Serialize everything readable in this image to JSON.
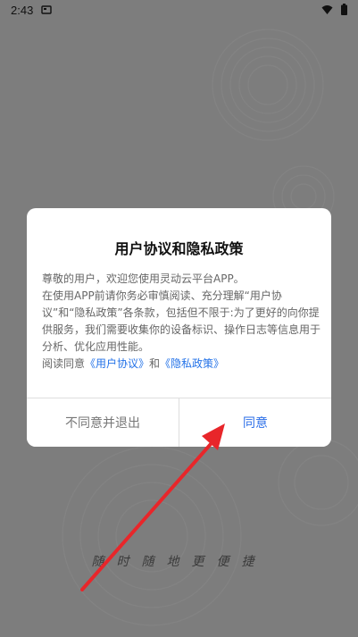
{
  "status_bar": {
    "time": "2:43",
    "icons": [
      "notification-icon",
      "wifi-icon",
      "battery-icon"
    ]
  },
  "dialog": {
    "title": "用户协议和隐私政策",
    "body_para1": "尊敬的用户，欢迎您使用灵动云平台APP。",
    "body_para2": "在使用APP前请你务必审慎阅读、充分理解“用户协议”和“隐私政策”各条款，包括但不限于:为了更好的向你提供服务，我们需要收集你的设备标识、操作日志等信息用于分析、优化应用性能。",
    "read_prefix": "阅读同意",
    "link_user_agreement": "《用户协议》",
    "conjunction": "和",
    "link_privacy_policy": "《隐私政策》",
    "decline_label": "不同意并退出",
    "agree_label": "同意"
  },
  "slogan": "随时随地更便捷",
  "colors": {
    "overlay": "#7d7d7d",
    "link": "#2372e8",
    "agree": "#2d6fe8",
    "annotation_arrow": "#e8262a"
  }
}
